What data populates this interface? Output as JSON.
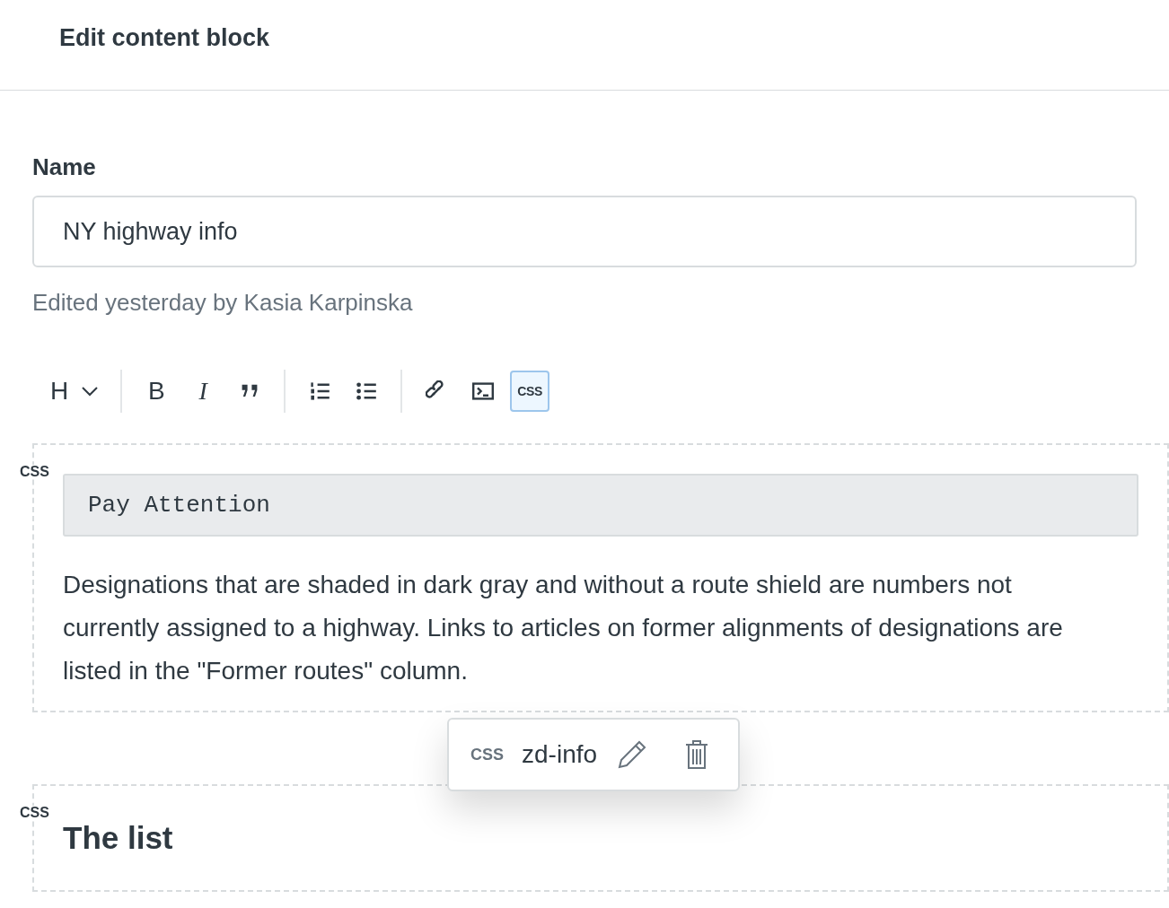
{
  "header": {
    "title": "Edit content block"
  },
  "name_field": {
    "label": "Name",
    "value": "NY highway info",
    "hint": "Edited yesterday by Kasia Karpinska"
  },
  "toolbar": [
    {
      "kind": "heading",
      "label": "H",
      "selected": false
    },
    {
      "kind": "divider"
    },
    {
      "kind": "bold",
      "label": "B",
      "selected": false
    },
    {
      "kind": "italic",
      "label": "I",
      "selected": false
    },
    {
      "kind": "quote",
      "selected": false
    },
    {
      "kind": "divider"
    },
    {
      "kind": "numbered",
      "selected": false
    },
    {
      "kind": "bullets",
      "selected": false
    },
    {
      "kind": "divider"
    },
    {
      "kind": "link",
      "selected": false
    },
    {
      "kind": "terminal",
      "selected": false
    },
    {
      "kind": "css",
      "label": "CSS",
      "selected": true
    }
  ],
  "blocks": [
    {
      "css_tag": "CSS",
      "content": [
        {
          "kind": "code",
          "text": "Pay Attention"
        },
        {
          "kind": "paragraph",
          "text": "Designations that are shaded in dark gray and without a route shield are numbers not currently assigned to a highway. Links to articles on former alignments of designations are listed in the \"Former routes\" column."
        }
      ]
    },
    {
      "css_tag": "CSS",
      "content": [
        {
          "kind": "heading",
          "text": "The list"
        }
      ]
    }
  ],
  "popover": {
    "tag": "CSS",
    "class_name": "zd-info"
  }
}
